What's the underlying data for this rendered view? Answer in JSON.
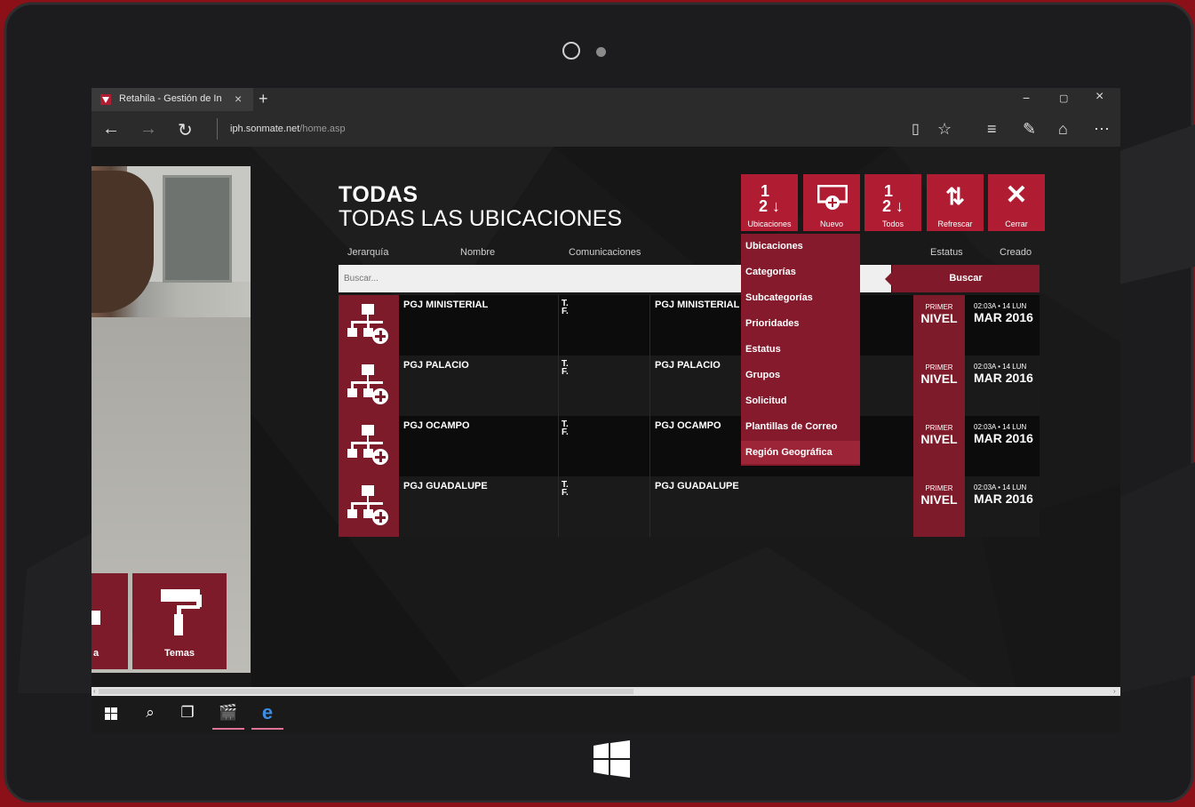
{
  "browser": {
    "tab_title": "Retahila - Gestión de In",
    "tab_close": "×",
    "new_tab": "+",
    "address_domain": "iph.sonmate.net",
    "address_path": "/home.asp",
    "window_controls": [
      "−",
      "▢",
      "×"
    ]
  },
  "app": {
    "heading_main": "TODAS",
    "heading_sub": "TODAS LAS UBICACIONES",
    "toolbar": [
      {
        "label": "Ubicaciones",
        "glyph": "1↓"
      },
      {
        "label": "Nuevo",
        "glyph": "⊕"
      },
      {
        "label": "Todos",
        "glyph": "1↓"
      },
      {
        "label": "Refrescar",
        "glyph": "⟳"
      },
      {
        "label": "Cerrar",
        "glyph": "✕"
      }
    ],
    "columns": {
      "jerarquia": "Jerarquía",
      "nombre": "Nombre",
      "comunicaciones": "Comunicaciones",
      "estatus": "Estatus",
      "creado": "Creado"
    },
    "search": {
      "placeholder": "Buscar...",
      "button": "Buscar"
    },
    "rows": [
      {
        "name": "PGJ MINISTERIAL",
        "tf": "T.\nF.",
        "com": "PGJ MINISTERIAL",
        "status_top": "PRIMER",
        "status": "NIVEL",
        "created_top": "02:03A • 14 LUN",
        "created": "MAR 2016"
      },
      {
        "name": "PGJ PALACIO",
        "tf": "T.\nF.",
        "com": "PGJ PALACIO",
        "status_top": "PRIMER",
        "status": "NIVEL",
        "created_top": "02:03A • 14 LUN",
        "created": "MAR 2016"
      },
      {
        "name": "PGJ OCAMPO",
        "tf": "T.\nF.",
        "com": "PGJ OCAMPO",
        "status_top": "PRIMER",
        "status": "NIVEL",
        "created_top": "02:03A • 14 LUN",
        "created": "MAR 2016"
      },
      {
        "name": "PGJ GUADALUPE",
        "tf": "T.\nF.",
        "com": "PGJ GUADALUPE",
        "status_top": "PRIMER",
        "status": "NIVEL",
        "created_top": "02:03A • 14 LUN",
        "created": "MAR 2016"
      }
    ],
    "dropdown": [
      "Ubicaciones",
      "Categorías",
      "Subcategorías",
      "Prioridades",
      "Estatus",
      "Grupos",
      "Solicitud",
      "Plantillas de Correo",
      "Región Geográfica"
    ],
    "dropdown_selected": "Región Geográfica",
    "tiles": {
      "left_label": "a",
      "temas": "Temas"
    }
  },
  "colors": {
    "accent": "#b01d33",
    "accent_dark": "#7e1b2a",
    "device_border": "#8c1017"
  },
  "icons": {
    "back": "arrow-left-icon",
    "forward": "arrow-right-icon",
    "refresh": "refresh-icon",
    "reading": "reading-view-icon",
    "favorite": "star-icon",
    "hub": "hub-icon",
    "note": "web-note-icon",
    "share": "share-icon",
    "more": "more-icon"
  }
}
